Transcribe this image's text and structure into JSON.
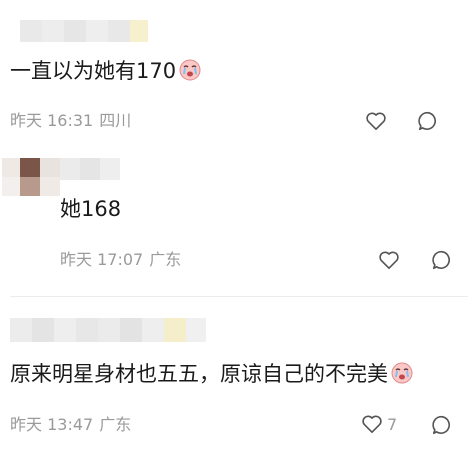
{
  "comments": [
    {
      "text": "一直以为她有170",
      "time": "昨天 16:31",
      "location": "四川",
      "like_count": "",
      "emoji": "crying-face-emoji"
    },
    {
      "text": "她168",
      "time": "昨天 17:07",
      "location": "广东",
      "like_count": ""
    },
    {
      "text": "原来明星身材也五五，原谅自己的不完美",
      "time": "昨天 13:47",
      "location": "广东",
      "like_count": "7",
      "emoji": "crying-face-emoji"
    }
  ],
  "colors": {
    "text": "#1a1a1a",
    "meta": "#9a9a9a",
    "divider": "#ececec"
  }
}
